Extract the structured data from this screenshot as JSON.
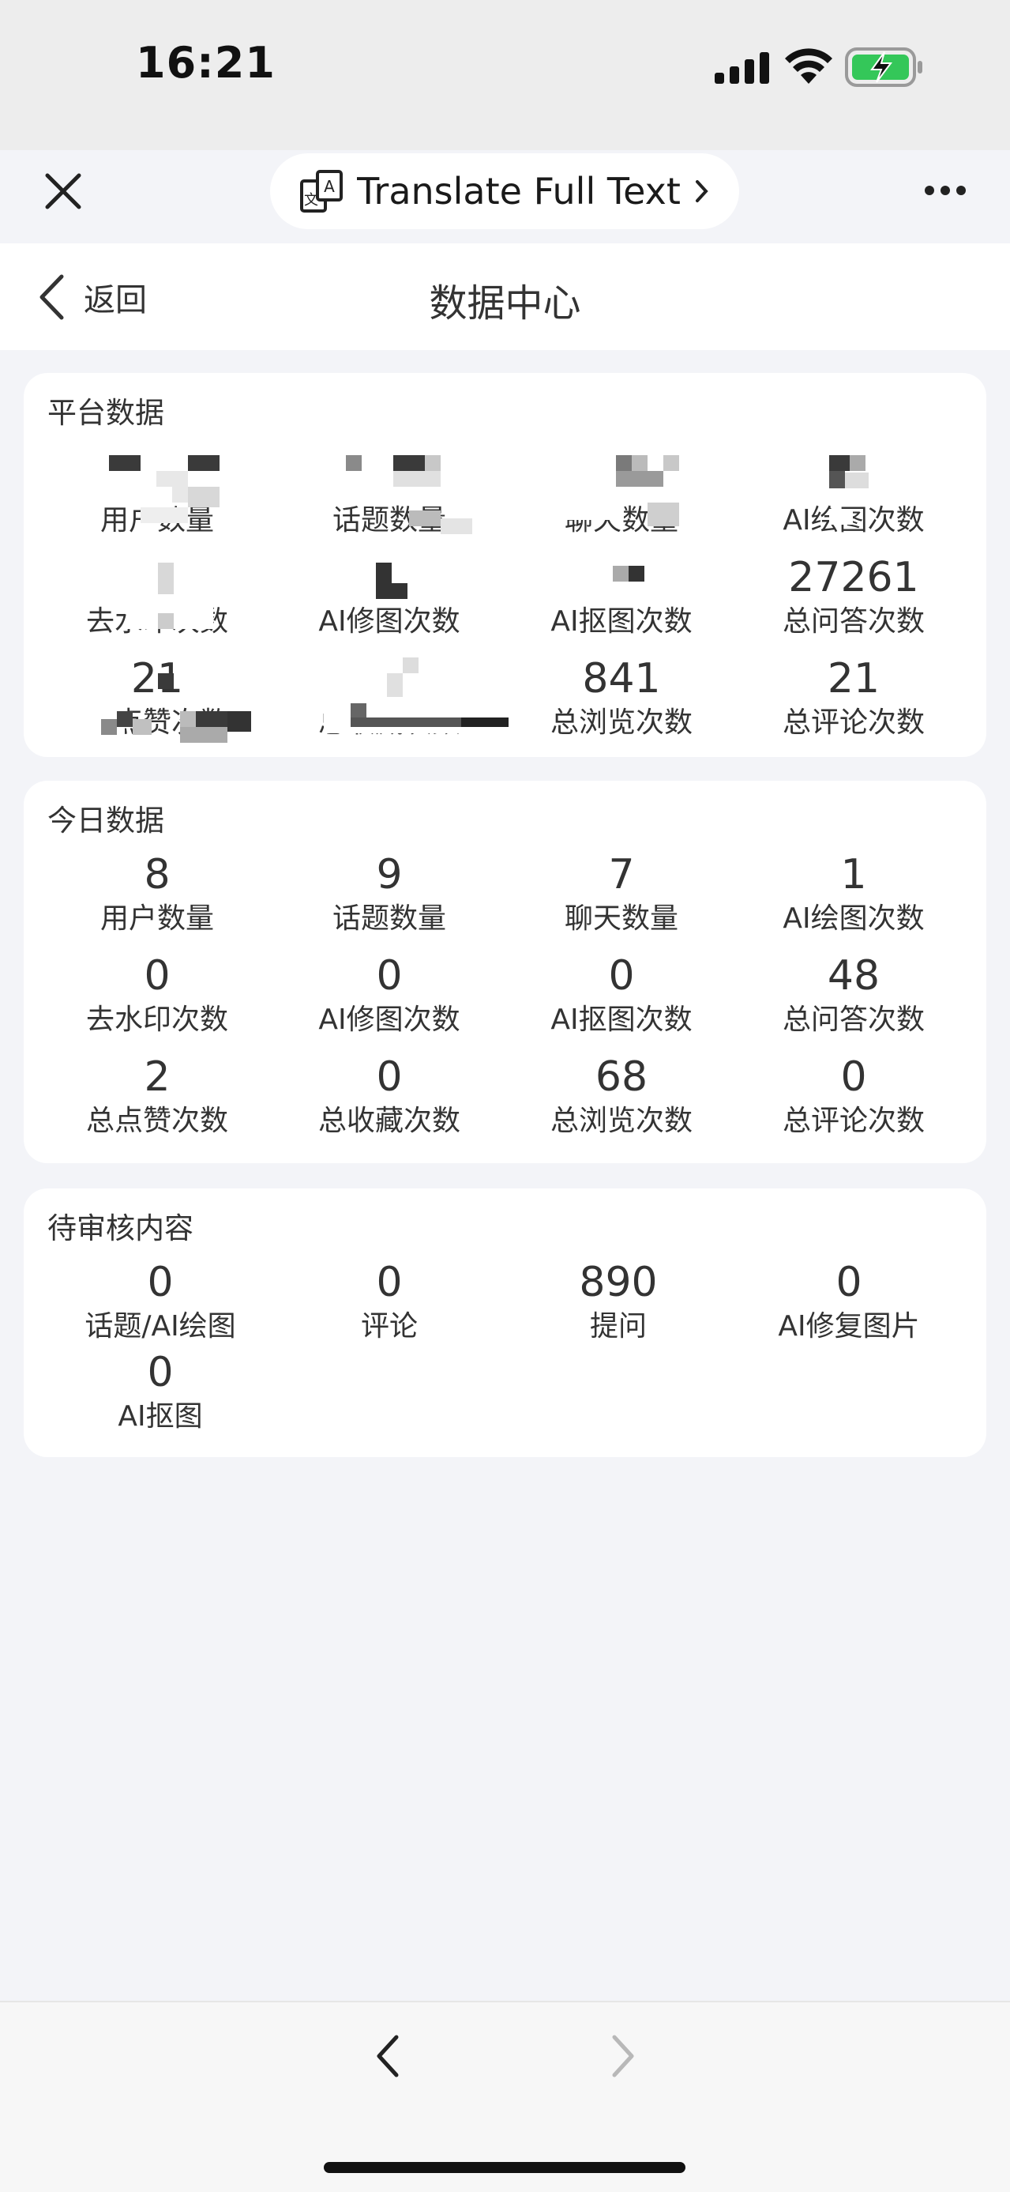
{
  "status_bar": {
    "time": "16:21"
  },
  "browser": {
    "translate_label": "Translate Full Text"
  },
  "header": {
    "back_label": "返回",
    "title": "数据中心"
  },
  "platform": {
    "title": "平台数据",
    "stats": [
      {
        "value": "",
        "label": "用户数量"
      },
      {
        "value": "",
        "label": "话题数量"
      },
      {
        "value": "",
        "label": "聊天数量"
      },
      {
        "value": "",
        "label": "AI绘图次数"
      },
      {
        "value": "",
        "label": "去水印次数"
      },
      {
        "value": "",
        "label": "AI修图次数"
      },
      {
        "value": "",
        "label": "AI抠图次数"
      },
      {
        "value": "27261",
        "label": "总问答次数"
      },
      {
        "value": "21",
        "label": "总点赞次数"
      },
      {
        "value": "",
        "label": "总收藏次数"
      },
      {
        "value": "841",
        "label": "总浏览次数"
      },
      {
        "value": "21",
        "label": "总评论次数"
      }
    ]
  },
  "today": {
    "title": "今日数据",
    "stats": [
      {
        "value": "8",
        "label": "用户数量"
      },
      {
        "value": "9",
        "label": "话题数量"
      },
      {
        "value": "7",
        "label": "聊天数量"
      },
      {
        "value": "1",
        "label": "AI绘图次数"
      },
      {
        "value": "0",
        "label": "去水印次数"
      },
      {
        "value": "0",
        "label": "AI修图次数"
      },
      {
        "value": "0",
        "label": "AI抠图次数"
      },
      {
        "value": "48",
        "label": "总问答次数"
      },
      {
        "value": "2",
        "label": "总点赞次数"
      },
      {
        "value": "0",
        "label": "总收藏次数"
      },
      {
        "value": "68",
        "label": "总浏览次数"
      },
      {
        "value": "0",
        "label": "总评论次数"
      }
    ]
  },
  "pending": {
    "title": "待审核内容",
    "stats": [
      {
        "value": "0",
        "label": "话题/AI绘图"
      },
      {
        "value": "0",
        "label": "评论"
      },
      {
        "value": "890",
        "label": "提问"
      },
      {
        "value": "0",
        "label": "AI修复图片"
      },
      {
        "value": "0",
        "label": "AI抠图"
      }
    ]
  },
  "colors": {
    "battery": "#34c759",
    "page_bg": "#f3f4f8",
    "card_bg": "#ffffff"
  }
}
